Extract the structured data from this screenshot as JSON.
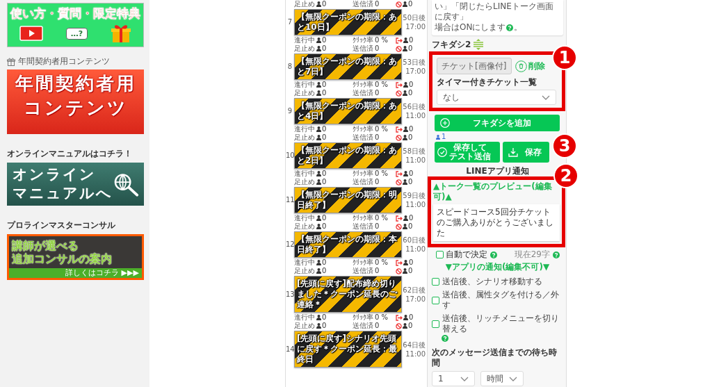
{
  "sidebar": {
    "usage_banner": {
      "title": "使い方・質問・限定特典",
      "bubble": "…?"
    },
    "annual_heading": "年間契約者用コンテンツ",
    "annual_banner": {
      "lines": [
        "年間契約者用",
        "コンテンツ"
      ]
    },
    "manual_heading": "オンラインマニュアルはコチラ！",
    "manual_banner": {
      "lines": [
        "オンライン",
        "マニュアルへ"
      ]
    },
    "consult_heading": "プロラインマスターコンサル",
    "consult_banner": {
      "lines": [
        "講師が選べる",
        "追加コンサルの案内"
      ],
      "more": "詳しくはコチラ ▶▶▶"
    }
  },
  "steps": [
    {
      "number": "7",
      "title": "【無限クーポンの期限：あと10日】",
      "days": "50日後",
      "time": "17:00",
      "top": [
        {
          "kind": "people",
          "label": "足止め",
          "value": "0"
        },
        {
          "kind": "plain",
          "label": "送信済",
          "value": "0"
        },
        {
          "kind": "blocked",
          "value": "0"
        }
      ],
      "bottom": [
        {
          "kind": "people",
          "label": "進行中",
          "value": "0"
        },
        {
          "kind": "plain",
          "label": "ｸﾘｯｸ率",
          "value": "0 %"
        },
        {
          "kind": "unfollowed",
          "value": "0"
        }
      ]
    },
    {
      "number": "8",
      "title": "【無限クーポンの期限：あと7日】",
      "days": "53日後",
      "time": "17:00",
      "top": [
        {
          "kind": "people",
          "label": "足止め",
          "value": "0"
        },
        {
          "kind": "plain",
          "label": "送信済",
          "value": "0"
        },
        {
          "kind": "blocked",
          "value": "0"
        }
      ],
      "bottom": [
        {
          "kind": "people",
          "label": "進行中",
          "value": "0"
        },
        {
          "kind": "plain",
          "label": "ｸﾘｯｸ率",
          "value": "0 %"
        },
        {
          "kind": "unfollowed",
          "value": "0"
        }
      ]
    },
    {
      "number": "9",
      "title": "【無限クーポンの期限：あと4日】",
      "days": "56日後",
      "time": "11:00",
      "top": [
        {
          "kind": "people",
          "label": "足止め",
          "value": "0"
        },
        {
          "kind": "plain",
          "label": "送信済",
          "value": "0"
        },
        {
          "kind": "blocked",
          "value": "0"
        }
      ],
      "bottom": [
        {
          "kind": "people",
          "label": "進行中",
          "value": "0"
        },
        {
          "kind": "plain",
          "label": "ｸﾘｯｸ率",
          "value": "0 %"
        },
        {
          "kind": "unfollowed",
          "value": "0"
        }
      ]
    },
    {
      "number": "10",
      "title": "【無限クーポンの期限：あと2日】",
      "days": "58日後",
      "time": "11:00",
      "top": [
        {
          "kind": "people",
          "label": "足止め",
          "value": "0"
        },
        {
          "kind": "plain",
          "label": "送信済",
          "value": "0"
        },
        {
          "kind": "blocked",
          "value": "0"
        }
      ],
      "bottom": [
        {
          "kind": "people",
          "label": "進行中",
          "value": "0"
        },
        {
          "kind": "plain",
          "label": "ｸﾘｯｸ率",
          "value": "0 %"
        },
        {
          "kind": "unfollowed",
          "value": "0"
        }
      ]
    },
    {
      "number": "11",
      "title": "【無限クーポンの期限：明日終了】",
      "days": "59日後",
      "time": "11:00",
      "top": [
        {
          "kind": "people",
          "label": "足止め",
          "value": "0"
        },
        {
          "kind": "plain",
          "label": "送信済",
          "value": "0"
        },
        {
          "kind": "blocked",
          "value": "0"
        }
      ],
      "bottom": [
        {
          "kind": "people",
          "label": "進行中",
          "value": "0"
        },
        {
          "kind": "plain",
          "label": "ｸﾘｯｸ率",
          "value": "0 %"
        },
        {
          "kind": "unfollowed",
          "value": "0"
        }
      ]
    },
    {
      "number": "12",
      "title": "【無限クーポンの期限：本日終了】",
      "days": "60日後",
      "time": "11:00",
      "top": [
        {
          "kind": "people",
          "label": "足止め",
          "value": "0"
        },
        {
          "kind": "plain",
          "label": "送信済",
          "value": "0"
        },
        {
          "kind": "blocked",
          "value": "0"
        }
      ],
      "bottom": [
        {
          "kind": "people",
          "label": "進行中",
          "value": "0"
        },
        {
          "kind": "plain",
          "label": "ｸﾘｯｸ率",
          "value": "0 %"
        },
        {
          "kind": "unfollowed",
          "value": "0"
        }
      ]
    },
    {
      "number": "13",
      "title": "[先頭に戻す]配布締め切りました＊クーポン延長のご連絡＊",
      "days": "62日後",
      "time": "17:00",
      "top": [
        {
          "kind": "people",
          "label": "足止め",
          "value": "0"
        },
        {
          "kind": "plain",
          "label": "送信済",
          "value": "0"
        },
        {
          "kind": "blocked",
          "value": "0"
        }
      ],
      "bottom": [
        {
          "kind": "people",
          "label": "進行中",
          "value": "0"
        },
        {
          "kind": "plain",
          "label": "ｸﾘｯｸ率",
          "value": "0 %"
        },
        {
          "kind": "unfollowed",
          "value": "0"
        }
      ]
    },
    {
      "number": "14",
      "title": "[先頭に戻す]シナリオ先頭に戻す＊クーポン延長：最終日",
      "days": "64日後",
      "time": "11:00",
      "top": [
        {
          "kind": "people",
          "label": "足止め",
          "value": "0"
        },
        {
          "kind": "plain",
          "label": "送信済",
          "value": "0"
        },
        {
          "kind": "blocked",
          "value": "0"
        }
      ]
    }
  ],
  "editor": {
    "intro_lines": [
      "い」「閉じたらLINEトーク画面に戻す」",
      "場合はONにします"
    ],
    "intro_end": "。",
    "balloon_label": "フキダシ2",
    "ticket_input": {
      "value": "チケット[画像付]",
      "disabled": true
    },
    "delete_button": "削除",
    "timer_label": "タイマー付きチケット一覧",
    "timer_select": "なし",
    "add_button": "フキダシを追加",
    "recipient_count": "1",
    "save_test_button": [
      "保存して",
      "テスト送信"
    ],
    "save_button": "保存",
    "notify_heading": "LINEアプリ通知",
    "preview_title": "▲トーク一覧のプレビュー(編集可)▲",
    "preview_text": "スピードコース5回分チケットのご購入ありがとうございました",
    "auto_decide": {
      "label": "自動で決定",
      "checked": false
    },
    "char_count": "現在29字",
    "app_notice": "▼アプリの通知(編集不可)▼",
    "options": [
      {
        "label": "送信後、シナリオ移動する",
        "checked": false,
        "help": false
      },
      {
        "label": "送信後、属性タグを付ける／外す",
        "checked": false,
        "help": false
      },
      {
        "label": "送信後、リッチメニューを切り替える",
        "checked": false,
        "help": true
      }
    ],
    "wait_label": "次のメッセージ送信までの待ち時間",
    "wait_amount": "1",
    "wait_unit": "時間"
  },
  "callouts": [
    "1",
    "3",
    "2"
  ]
}
